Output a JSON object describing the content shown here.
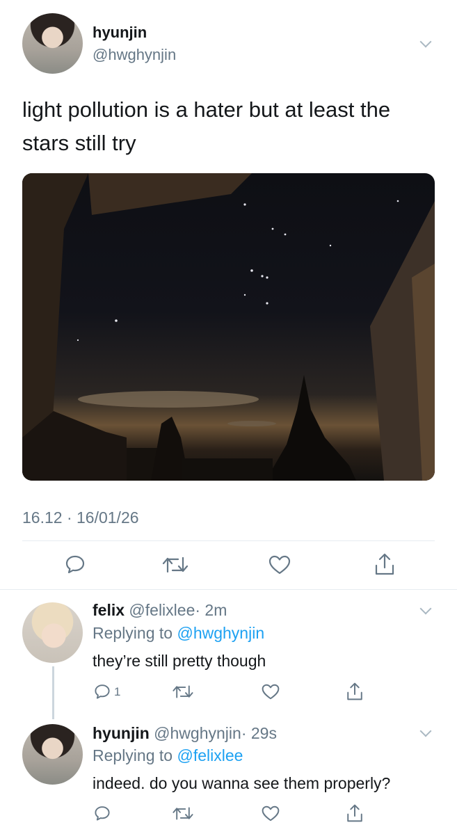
{
  "main_tweet": {
    "display_name": "hyunjin",
    "handle": "@hwghynjin",
    "text": "light pollution is a hater but at least the stars still try",
    "timestamp": "16.12 · 16/01/26"
  },
  "replies": [
    {
      "display_name": "felix",
      "handle": "@felixlee",
      "time": "· 2m",
      "replying_prefix": "Replying to",
      "replying_to": "@hwghynjin",
      "text": "they’re still pretty though",
      "reply_count": "1"
    },
    {
      "display_name": "hyunjin",
      "handle": "@hwghynjin",
      "time": "· 29s",
      "replying_prefix": "Replying to",
      "replying_to": "@felixlee",
      "text": "indeed. do you wanna see them properly?",
      "reply_count": ""
    }
  ],
  "colors": {
    "link": "#1da1f2",
    "muted": "#657786",
    "divider": "#e6ecf0",
    "icon": "#657786"
  }
}
